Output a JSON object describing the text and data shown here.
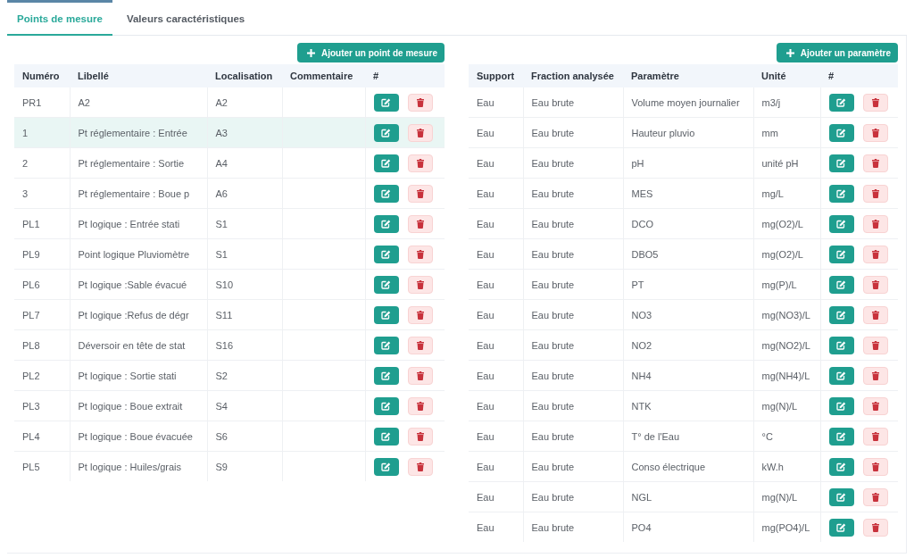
{
  "tabs": [
    {
      "label": "Points de mesure",
      "selected": true
    },
    {
      "label": "Valeurs caractéristiques",
      "selected": false
    }
  ],
  "measure_points": {
    "add_button": "Ajouter un point de mesure",
    "columns": [
      "Numéro",
      "Libellé",
      "Localisation",
      "Commentaire",
      "#"
    ],
    "rows": [
      {
        "number": "PR1",
        "label": "A2",
        "location": "A2",
        "selected": false
      },
      {
        "number": "1",
        "label": "Pt réglementaire : Entrée",
        "location": "A3",
        "selected": true
      },
      {
        "number": "2",
        "label": "Pt réglementaire : Sortie",
        "location": "A4",
        "selected": false
      },
      {
        "number": "3",
        "label": "Pt réglementaire : Boue p",
        "location": "A6",
        "selected": false
      },
      {
        "number": "PL1",
        "label": "Pt logique : Entrée stati",
        "location": "S1",
        "selected": false
      },
      {
        "number": "PL9",
        "label": "Point logique Pluviomètre",
        "location": "S1",
        "selected": false
      },
      {
        "number": "PL6",
        "label": "Pt logique :Sable évacué",
        "location": "S10",
        "selected": false
      },
      {
        "number": "PL7",
        "label": "Pt logique :Refus de dégr",
        "location": "S11",
        "selected": false
      },
      {
        "number": "PL8",
        "label": "Déversoir en tête de stat",
        "location": "S16",
        "selected": false
      },
      {
        "number": "PL2",
        "label": "Pt logique : Sortie stati",
        "location": "S2",
        "selected": false
      },
      {
        "number": "PL3",
        "label": "Pt logique : Boue extrait",
        "location": "S4",
        "selected": false
      },
      {
        "number": "PL4",
        "label": "Pt logique : Boue évacuée",
        "location": "S6",
        "selected": false
      },
      {
        "number": "PL5",
        "label": "Pt logique : Huiles/grais",
        "location": "S9",
        "selected": false
      }
    ]
  },
  "parameters": {
    "add_button": "Ajouter un paramètre",
    "columns": [
      "Support",
      "Fraction analysée",
      "Paramètre",
      "Unité",
      "#"
    ],
    "rows": [
      {
        "support": "Eau",
        "fraction": "Eau brute",
        "parameter": "Volume moyen journalier",
        "unit": "m3/j",
        "selected": false
      },
      {
        "support": "Eau",
        "fraction": "Eau brute",
        "parameter": "Hauteur pluvio",
        "unit": "mm",
        "selected": false
      },
      {
        "support": "Eau",
        "fraction": "Eau brute",
        "parameter": "pH",
        "unit": "unité pH",
        "selected": false
      },
      {
        "support": "Eau",
        "fraction": "Eau brute",
        "parameter": "MES",
        "unit": "mg/L",
        "selected": false
      },
      {
        "support": "Eau",
        "fraction": "Eau brute",
        "parameter": "DCO",
        "unit": "mg(O2)/L",
        "selected": false
      },
      {
        "support": "Eau",
        "fraction": "Eau brute",
        "parameter": "DBO5",
        "unit": "mg(O2)/L",
        "selected": false
      },
      {
        "support": "Eau",
        "fraction": "Eau brute",
        "parameter": "PT",
        "unit": "mg(P)/L",
        "selected": false
      },
      {
        "support": "Eau",
        "fraction": "Eau brute",
        "parameter": "NO3",
        "unit": "mg(NO3)/L",
        "selected": false
      },
      {
        "support": "Eau",
        "fraction": "Eau brute",
        "parameter": "NO2",
        "unit": "mg(NO2)/L",
        "selected": false
      },
      {
        "support": "Eau",
        "fraction": "Eau brute",
        "parameter": "NH4",
        "unit": "mg(NH4)/L",
        "selected": false
      },
      {
        "support": "Eau",
        "fraction": "Eau brute",
        "parameter": "NTK",
        "unit": "mg(N)/L",
        "selected": false
      },
      {
        "support": "Eau",
        "fraction": "Eau brute",
        "parameter": "T° de l'Eau",
        "unit": "°C",
        "selected": false
      },
      {
        "support": "Eau",
        "fraction": "Eau brute",
        "parameter": "Conso électrique",
        "unit": "kW.h",
        "selected": false
      },
      {
        "support": "Eau",
        "fraction": "Eau brute",
        "parameter": "NGL",
        "unit": "mg(N)/L",
        "selected": false
      },
      {
        "support": "Eau",
        "fraction": "Eau brute",
        "parameter": "PO4",
        "unit": "mg(PO4)/L",
        "selected": false
      }
    ]
  }
}
